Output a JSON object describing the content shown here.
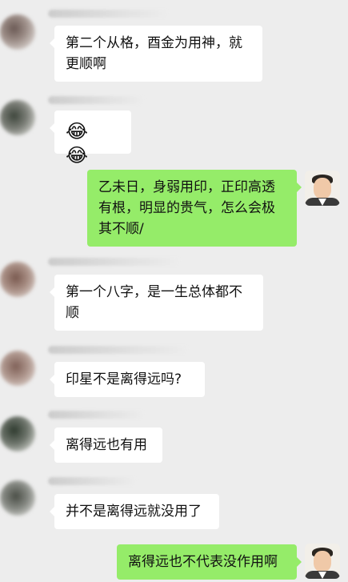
{
  "messages": [
    {
      "side": "in",
      "text": "第二个从格，酉金为用神，就更顺啊"
    },
    {
      "side": "in",
      "text": "😂😂"
    },
    {
      "side": "out",
      "text": "乙未日，身弱用印，正印高透有根，明显的贵气，怎么会极其不顺/"
    },
    {
      "side": "in",
      "text": "第一个八字，是一生总体都不顺"
    },
    {
      "side": "in",
      "text": "印星不是离得远吗?"
    },
    {
      "side": "in",
      "text": "离得远也有用"
    },
    {
      "side": "in",
      "text": "并不是离得远就没用了"
    },
    {
      "side": "out",
      "text": "离得远也不代表没作用啊"
    }
  ],
  "colors": {
    "background": "#ededed",
    "incoming_bubble": "#ffffff",
    "outgoing_bubble": "#95ec69"
  }
}
